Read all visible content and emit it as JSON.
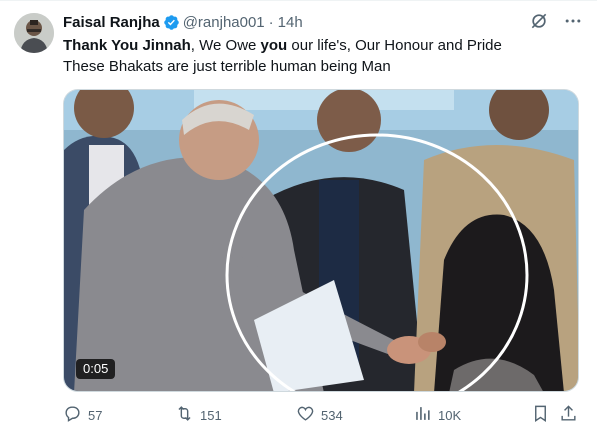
{
  "tweet": {
    "author_name": "Faisal Ranjha",
    "author_handle": "@ranjha001",
    "separator": "·",
    "time": "14h",
    "text_line1_bold1": "Thank You Jinnah",
    "text_line1_part2": ", We Owe ",
    "text_line1_bold2": "you",
    "text_line1_part3": " our life's, Our Honour and Pride",
    "text_line2": "These Bhakats are just terrible human being Man",
    "video_duration": "0:05"
  },
  "actions": {
    "replies": "57",
    "reposts": "151",
    "likes": "534",
    "views": "10K"
  },
  "icons": {
    "verified": "verified-badge-icon",
    "grok": "grok-icon",
    "more": "more-icon",
    "reply": "reply-icon",
    "repost": "repost-icon",
    "like": "heart-icon",
    "views": "views-icon",
    "bookmark": "bookmark-icon",
    "share": "share-icon"
  },
  "colors": {
    "text_primary": "#0f1419",
    "text_secondary": "#536471",
    "verified_blue": "#1d9bf0"
  }
}
